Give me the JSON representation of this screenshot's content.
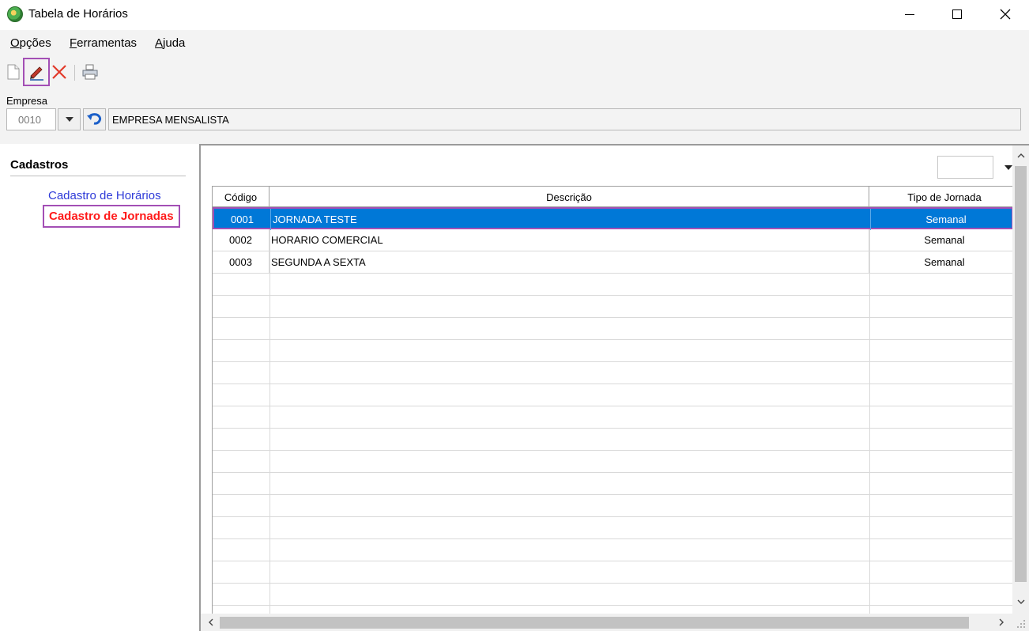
{
  "window": {
    "title": "Tabela de Horários"
  },
  "menu": {
    "items": [
      {
        "prefix": "",
        "accel": "O",
        "rest": "pções"
      },
      {
        "prefix": "",
        "accel": "F",
        "rest": "erramentas"
      },
      {
        "prefix": "",
        "accel": "A",
        "rest": "juda"
      }
    ]
  },
  "toolbar": {
    "icons": [
      "new-document-icon",
      "edit-pencil-icon",
      "delete-x-icon",
      "print-icon"
    ]
  },
  "empresa": {
    "label": "Empresa",
    "code": "0010",
    "name": "EMPRESA MENSALISTA"
  },
  "sidebar": {
    "title": "Cadastros",
    "links": [
      {
        "label": "Cadastro de Horários"
      },
      {
        "label": "Cadastro de Jornadas"
      }
    ]
  },
  "grid": {
    "columns": [
      "Código",
      "Descrição",
      "Tipo de Jornada"
    ],
    "rows": [
      {
        "codigo": "0001",
        "descricao": "JORNADA TESTE",
        "tipo": "Semanal"
      },
      {
        "codigo": "0002",
        "descricao": "HORARIO COMERCIAL",
        "tipo": "Semanal"
      },
      {
        "codigo": "0003",
        "descricao": "SEGUNDA A SEXTA",
        "tipo": "Semanal"
      }
    ],
    "selected_row": 0
  },
  "colors": {
    "selection": "#0078d7",
    "highlight_border": "#a34fb5",
    "link_blue": "#2f3bd8",
    "link_red": "#ff1a1a"
  }
}
